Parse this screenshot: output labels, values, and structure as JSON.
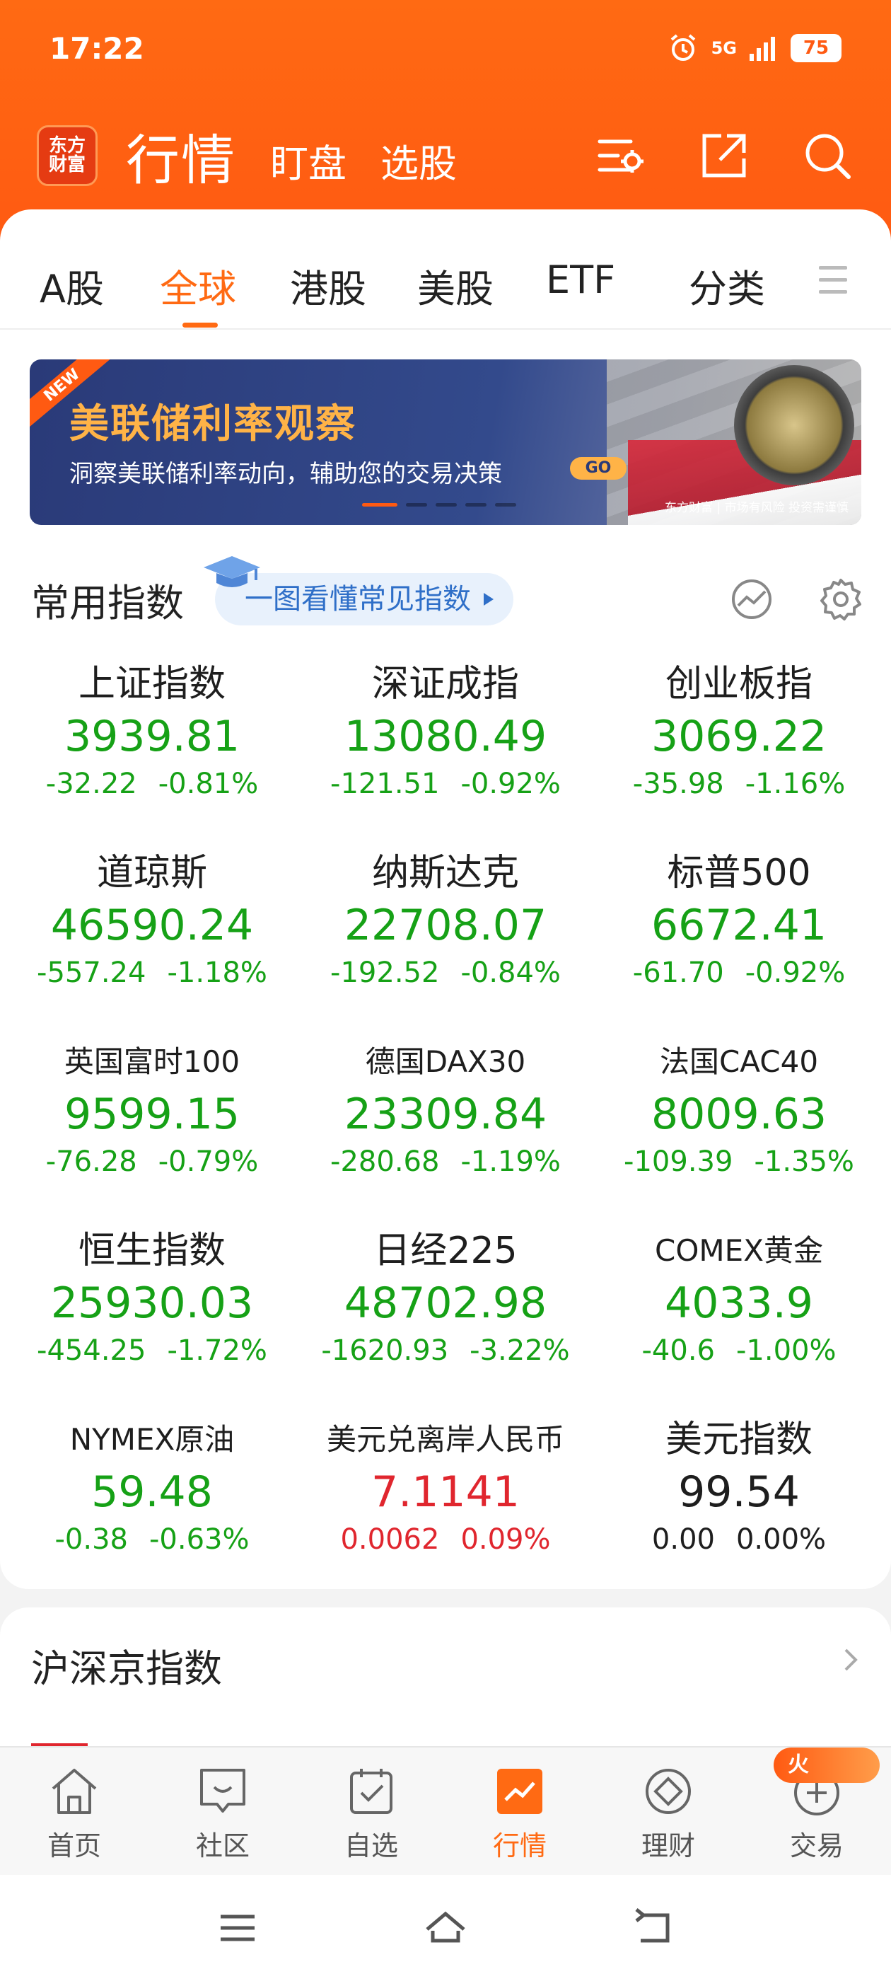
{
  "status_bar": {
    "time": "17:22",
    "network": "5G",
    "battery": "75"
  },
  "header": {
    "logo_line1": "东方",
    "logo_line2": "财富",
    "title": "行情",
    "links": [
      "盯盘",
      "选股"
    ],
    "icons": [
      "settings-list-icon",
      "share-icon",
      "search-icon"
    ]
  },
  "tabs": {
    "items": [
      "A股",
      "全球",
      "港股",
      "美股",
      "ETF",
      "分类"
    ],
    "active": "全球"
  },
  "banner": {
    "ribbon": "NEW",
    "title": "美联储利率观察",
    "subtitle": "洞察美联储利率动向，辅助您的交易决策",
    "go": "GO",
    "disclaimer": "东方财富 | 市场有风险 投资需谨慎"
  },
  "section": {
    "title": "常用指数",
    "guide": "一图看懂常见指数"
  },
  "indices": [
    {
      "name": "上证指数",
      "price": "3939.81",
      "change": "-32.22",
      "pct": "-0.81%",
      "dir": "down"
    },
    {
      "name": "深证成指",
      "price": "13080.49",
      "change": "-121.51",
      "pct": "-0.92%",
      "dir": "down"
    },
    {
      "name": "创业板指",
      "price": "3069.22",
      "change": "-35.98",
      "pct": "-1.16%",
      "dir": "down"
    },
    {
      "name": "道琼斯",
      "price": "46590.24",
      "change": "-557.24",
      "pct": "-1.18%",
      "dir": "down"
    },
    {
      "name": "纳斯达克",
      "price": "22708.07",
      "change": "-192.52",
      "pct": "-0.84%",
      "dir": "down"
    },
    {
      "name": "标普500",
      "price": "6672.41",
      "change": "-61.70",
      "pct": "-0.92%",
      "dir": "down"
    },
    {
      "name": "英国富时100",
      "price": "9599.15",
      "change": "-76.28",
      "pct": "-0.79%",
      "dir": "down"
    },
    {
      "name": "德国DAX30",
      "price": "23309.84",
      "change": "-280.68",
      "pct": "-1.19%",
      "dir": "down"
    },
    {
      "name": "法国CAC40",
      "price": "8009.63",
      "change": "-109.39",
      "pct": "-1.35%",
      "dir": "down"
    },
    {
      "name": "恒生指数",
      "price": "25930.03",
      "change": "-454.25",
      "pct": "-1.72%",
      "dir": "down"
    },
    {
      "name": "日经225",
      "price": "48702.98",
      "change": "-1620.93",
      "pct": "-3.22%",
      "dir": "down"
    },
    {
      "name": "COMEX黄金",
      "price": "4033.9",
      "change": "-40.6",
      "pct": "-1.00%",
      "dir": "down"
    },
    {
      "name": "NYMEX原油",
      "price": "59.48",
      "change": "-0.38",
      "pct": "-0.63%",
      "dir": "down"
    },
    {
      "name": "美元兑离岸人民币",
      "price": "7.1141",
      "change": "0.0062",
      "pct": "0.09%",
      "dir": "up"
    },
    {
      "name": "美元指数",
      "price": "99.54",
      "change": "0.00",
      "pct": "0.00%",
      "dir": "flat"
    }
  ],
  "section2": {
    "title": "沪深京指数"
  },
  "bottom_tabs": {
    "items": [
      "首页",
      "社区",
      "自选",
      "行情",
      "理财",
      "交易"
    ],
    "active": "行情",
    "badge": "火"
  },
  "colors": {
    "accent": "#ff6a13",
    "down": "#16a116",
    "up": "#e0262e"
  }
}
